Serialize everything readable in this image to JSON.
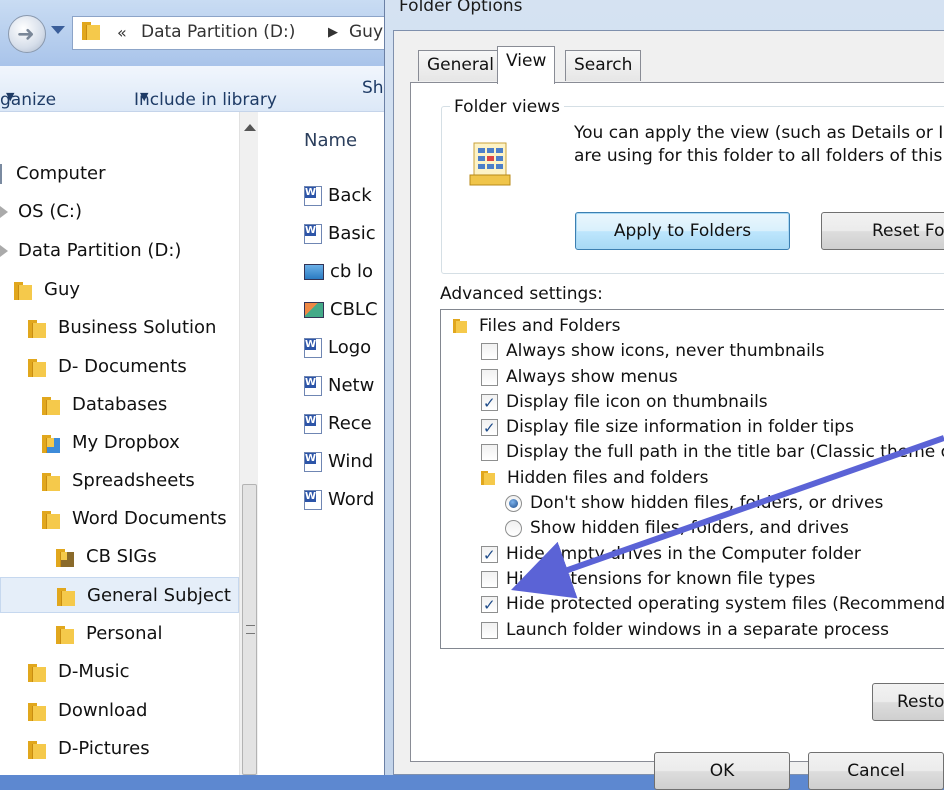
{
  "explorer": {
    "address": {
      "chevron": "«",
      "segment1": "Data Partition (D:)",
      "separator": "▶",
      "segment2": "Guy"
    },
    "toolbar": {
      "organize": "ganize",
      "include": "Include in library",
      "share": "Sh"
    },
    "tree": [
      {
        "label": "Computer",
        "icon": "computer-icon"
      },
      {
        "label": "OS (C:)",
        "icon": "drive-icon"
      },
      {
        "label": "Data Partition (D:)",
        "icon": "drive-icon"
      },
      {
        "label": "Guy",
        "icon": "folder-icon"
      },
      {
        "label": "Business Solution",
        "icon": "folder-icon"
      },
      {
        "label": "D- Documents",
        "icon": "folder-icon"
      },
      {
        "label": "Databases",
        "icon": "folder-icon"
      },
      {
        "label": "My Dropbox",
        "icon": "dropbox-folder-icon"
      },
      {
        "label": "Spreadsheets",
        "icon": "folder-icon"
      },
      {
        "label": "Word Documents",
        "icon": "folder-icon"
      },
      {
        "label": "CB SIGs",
        "icon": "locked-folder-icon"
      },
      {
        "label": "General Subject",
        "icon": "folder-icon",
        "selected": true
      },
      {
        "label": "Personal",
        "icon": "folder-icon"
      },
      {
        "label": "D-Music",
        "icon": "folder-icon"
      },
      {
        "label": "Download",
        "icon": "folder-icon"
      },
      {
        "label": "D-Pictures",
        "icon": "folder-icon"
      }
    ],
    "files": {
      "column_name": "Name",
      "items": [
        {
          "label": "Back",
          "icon": "word-doc-icon"
        },
        {
          "label": "Basic",
          "icon": "word-doc-icon"
        },
        {
          "label": "cb lo",
          "icon": "image-file-icon"
        },
        {
          "label": "CBLC",
          "icon": "picture-file-icon"
        },
        {
          "label": "Logo",
          "icon": "word-doc-icon"
        },
        {
          "label": "Netw",
          "icon": "word-doc-icon"
        },
        {
          "label": "Rece",
          "icon": "word-doc-icon"
        },
        {
          "label": "Wind",
          "icon": "word-doc-icon"
        },
        {
          "label": "Word",
          "icon": "word-doc-icon"
        }
      ]
    }
  },
  "dialog": {
    "title": "Folder Options",
    "tabs": [
      "General",
      "View",
      "Search"
    ],
    "active_tab": "View",
    "folder_views": {
      "title": "Folder views",
      "text_line1": "You can apply the view (such as Details or Ic",
      "text_line2": "are using for this folder to all folders of this typ",
      "apply_button": "Apply to Folders",
      "reset_button": "Reset Fo"
    },
    "advanced_label": "Advanced settings:",
    "advanced": [
      {
        "kind": "folder",
        "label": "Files and Folders"
      },
      {
        "kind": "checkbox",
        "label": "Always show icons, never thumbnails",
        "checked": false
      },
      {
        "kind": "checkbox",
        "label": "Always show menus",
        "checked": false
      },
      {
        "kind": "checkbox",
        "label": "Display file icon on thumbnails",
        "checked": true
      },
      {
        "kind": "checkbox",
        "label": "Display file size information in folder tips",
        "checked": true
      },
      {
        "kind": "checkbox",
        "label": "Display the full path in the title bar (Classic theme only)",
        "checked": false
      },
      {
        "kind": "folder",
        "label": "Hidden files and folders"
      },
      {
        "kind": "radio",
        "label": "Don't show hidden files, folders, or drives",
        "checked": true
      },
      {
        "kind": "radio",
        "label": "Show hidden files, folders, and drives",
        "checked": false
      },
      {
        "kind": "checkbox",
        "label": "Hide empty drives in the Computer folder",
        "checked": true
      },
      {
        "kind": "checkbox",
        "label": "Hide extensions for known file types",
        "checked": false
      },
      {
        "kind": "checkbox",
        "label": "Hide protected operating system files (Recommended)",
        "checked": true
      },
      {
        "kind": "checkbox",
        "label": "Launch folder windows in a separate process",
        "checked": false
      }
    ],
    "restore_button": "Resto",
    "ok_button": "OK",
    "cancel_button": "Cancel"
  },
  "colors": {
    "annotation_arrow": "#5b63d6",
    "accent_blue": "#3c7fb1"
  }
}
